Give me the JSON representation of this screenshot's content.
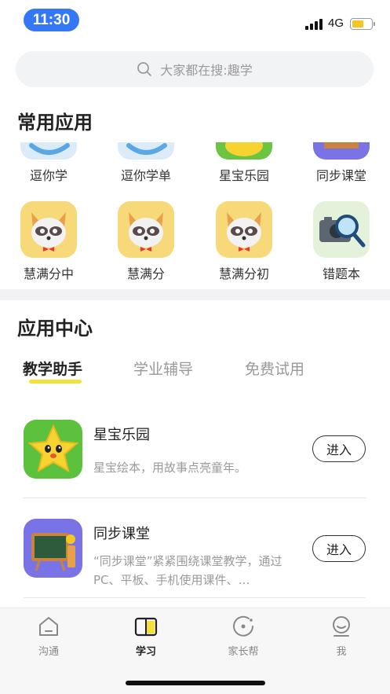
{
  "status_bar": {
    "time": "11:30",
    "network": "4G",
    "battery_level": 0.6
  },
  "search": {
    "placeholder": "大家都在搜:趣学"
  },
  "common_apps": {
    "title": "常用应用",
    "items": [
      {
        "label": "逗你学",
        "icon": "blue-swirl-icon"
      },
      {
        "label": "逗你学单",
        "icon": "blue-swirl-icon"
      },
      {
        "label": "星宝乐园",
        "icon": "star-mascot-icon"
      },
      {
        "label": "同步课堂",
        "icon": "classroom-board-icon"
      },
      {
        "label": "慧满分中",
        "icon": "raccoon-mascot-icon"
      },
      {
        "label": "慧满分",
        "icon": "raccoon-mascot-icon"
      },
      {
        "label": "慧满分初",
        "icon": "raccoon-mascot-icon"
      },
      {
        "label": "错题本",
        "icon": "camera-magnifier-icon"
      }
    ]
  },
  "app_center": {
    "title": "应用中心",
    "tabs": [
      {
        "label": "教学助手",
        "active": true
      },
      {
        "label": "学业辅导",
        "active": false
      },
      {
        "label": "免费试用",
        "active": false
      }
    ],
    "items": [
      {
        "name": "星宝乐园",
        "desc": "星宝绘本，用故事点亮童年。",
        "button": "进入",
        "icon": "star-mascot-icon"
      },
      {
        "name": "同步课堂",
        "desc": "“同步课堂”紧紧围绕课堂教学，通过PC、平板、手机使用课件、…",
        "button": "进入",
        "icon": "classroom-board-icon"
      }
    ]
  },
  "tab_bar": {
    "items": [
      {
        "label": "沟通",
        "icon": "home-icon",
        "active": false
      },
      {
        "label": "学习",
        "icon": "book-icon",
        "active": true
      },
      {
        "label": "家长帮",
        "icon": "compass-icon",
        "active": false
      },
      {
        "label": "我",
        "icon": "profile-icon",
        "active": false
      }
    ]
  },
  "colors": {
    "accent": "#f5e03a",
    "time_pill": "#3478f6",
    "battery": "#f3c623"
  }
}
